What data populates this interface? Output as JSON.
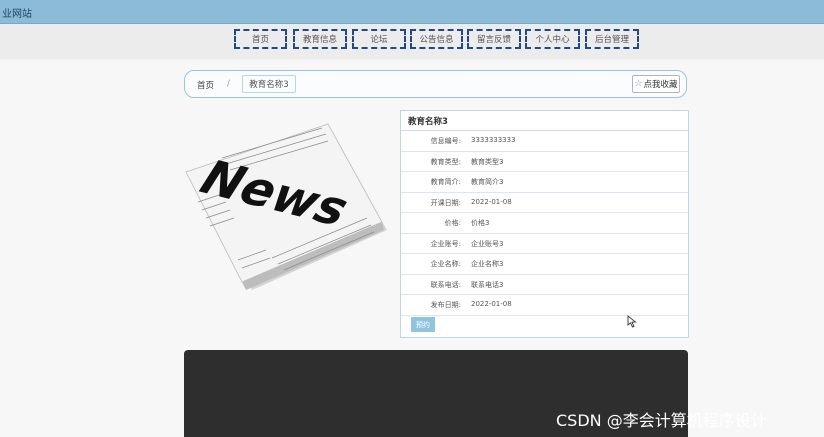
{
  "header": {
    "site_title": "业网站"
  },
  "nav": {
    "items": [
      {
        "label": "首页"
      },
      {
        "label": "教育信息"
      },
      {
        "label": "论坛"
      },
      {
        "label": "公告信息"
      },
      {
        "label": "留言反馈"
      },
      {
        "label": "个人中心"
      },
      {
        "label": "后台管理"
      }
    ]
  },
  "breadcrumb": {
    "home": "首页",
    "separator": "/",
    "current": "教育名称3"
  },
  "favorite": {
    "icon": "star-icon",
    "label": "点我收藏"
  },
  "media": {
    "news_text": "News"
  },
  "detail": {
    "title": "教育名称3",
    "rows": [
      {
        "label": "信息编号:",
        "value": "3333333333"
      },
      {
        "label": "教育类型:",
        "value": "教育类型3"
      },
      {
        "label": "教育简介:",
        "value": "教育简介3"
      },
      {
        "label": "开课日期:",
        "value": "2022-01-08"
      },
      {
        "label": "价格:",
        "value": "价格3"
      },
      {
        "label": "企业账号:",
        "value": "企业账号3"
      },
      {
        "label": "企业名称:",
        "value": "企业名称3"
      },
      {
        "label": "联系电话:",
        "value": "联系电话3"
      },
      {
        "label": "发布日期:",
        "value": "2022-01-08"
      }
    ],
    "buy_label": "预约"
  },
  "watermark": "CSDN @李会计算机程序设计",
  "colors": {
    "topbar": "#8cbbd7",
    "nav_border": "#1f4a86",
    "button": "#8fc4dd",
    "dark_panel": "#2e2e2e"
  }
}
